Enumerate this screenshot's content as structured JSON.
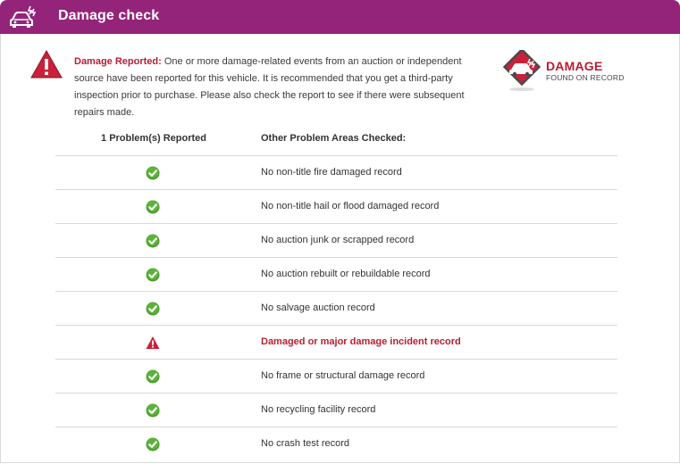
{
  "header": {
    "title": "Damage check",
    "icon": "car-alert-icon"
  },
  "alert": {
    "highlight": "Damage Reported:",
    "text": " One or more damage-related events from an auction or independent source have been reported for this vehicle. It is recommended that you get a third-party inspection prior to purchase. Please also check the report to see if there were subsequent repairs made.",
    "icon": "warning-triangle-icon"
  },
  "badge": {
    "line1": "DAMAGE",
    "line2": "FOUND ON RECORD"
  },
  "table": {
    "col1_header": "1 Problem(s) Reported",
    "col2_header": "Other Problem Areas Checked:",
    "rows": [
      {
        "status": "ok",
        "label": "No non-title fire damaged record"
      },
      {
        "status": "ok",
        "label": "No non-title hail or flood damaged record"
      },
      {
        "status": "ok",
        "label": "No auction junk or scrapped record"
      },
      {
        "status": "ok",
        "label": "No auction rebuilt or rebuildable record"
      },
      {
        "status": "ok",
        "label": "No salvage auction record"
      },
      {
        "status": "problem",
        "label": "Damaged or major damage incident record"
      },
      {
        "status": "ok",
        "label": "No frame or structural damage record"
      },
      {
        "status": "ok",
        "label": "No recycling facility record"
      },
      {
        "status": "ok",
        "label": "No crash test record"
      }
    ]
  },
  "colors": {
    "brand": "#94247a",
    "alert": "#b81d33",
    "ok": "#4a9a2c"
  }
}
